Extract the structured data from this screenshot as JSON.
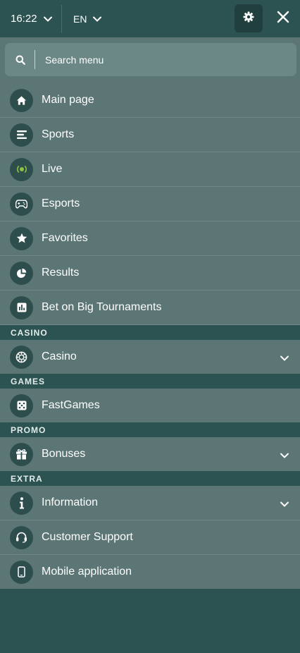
{
  "header": {
    "time": "16:22",
    "language": "EN"
  },
  "search": {
    "placeholder": "Search menu"
  },
  "menu": {
    "main": [
      {
        "label": "Main page",
        "icon": "home-icon"
      },
      {
        "label": "Sports",
        "icon": "sports-list-icon"
      },
      {
        "label": "Live",
        "icon": "live-broadcast-icon"
      },
      {
        "label": "Esports",
        "icon": "gamepad-icon"
      },
      {
        "label": "Favorites",
        "icon": "star-icon"
      },
      {
        "label": "Results",
        "icon": "pie-chart-icon"
      },
      {
        "label": "Bet on Big Tournaments",
        "icon": "bar-chart-icon"
      }
    ],
    "casino_section": "CASINO",
    "casino": [
      {
        "label": "Casino",
        "icon": "casino-chip-icon"
      }
    ],
    "games_section": "GAMES",
    "games": [
      {
        "label": "FastGames",
        "icon": "dice-icon"
      }
    ],
    "promo_section": "PROMO",
    "promo": [
      {
        "label": "Bonuses",
        "icon": "gift-icon"
      }
    ],
    "extra_section": "EXTRA",
    "extra": [
      {
        "label": "Information",
        "icon": "info-icon"
      },
      {
        "label": "Customer Support",
        "icon": "headset-icon"
      },
      {
        "label": "Mobile application",
        "icon": "smartphone-icon"
      }
    ]
  },
  "colors": {
    "background": "#2c5352",
    "item_background": "#5b7674",
    "icon_background": "#2e4e4d",
    "live_accent": "#8bc43f",
    "gear_button": "#203f3e"
  }
}
